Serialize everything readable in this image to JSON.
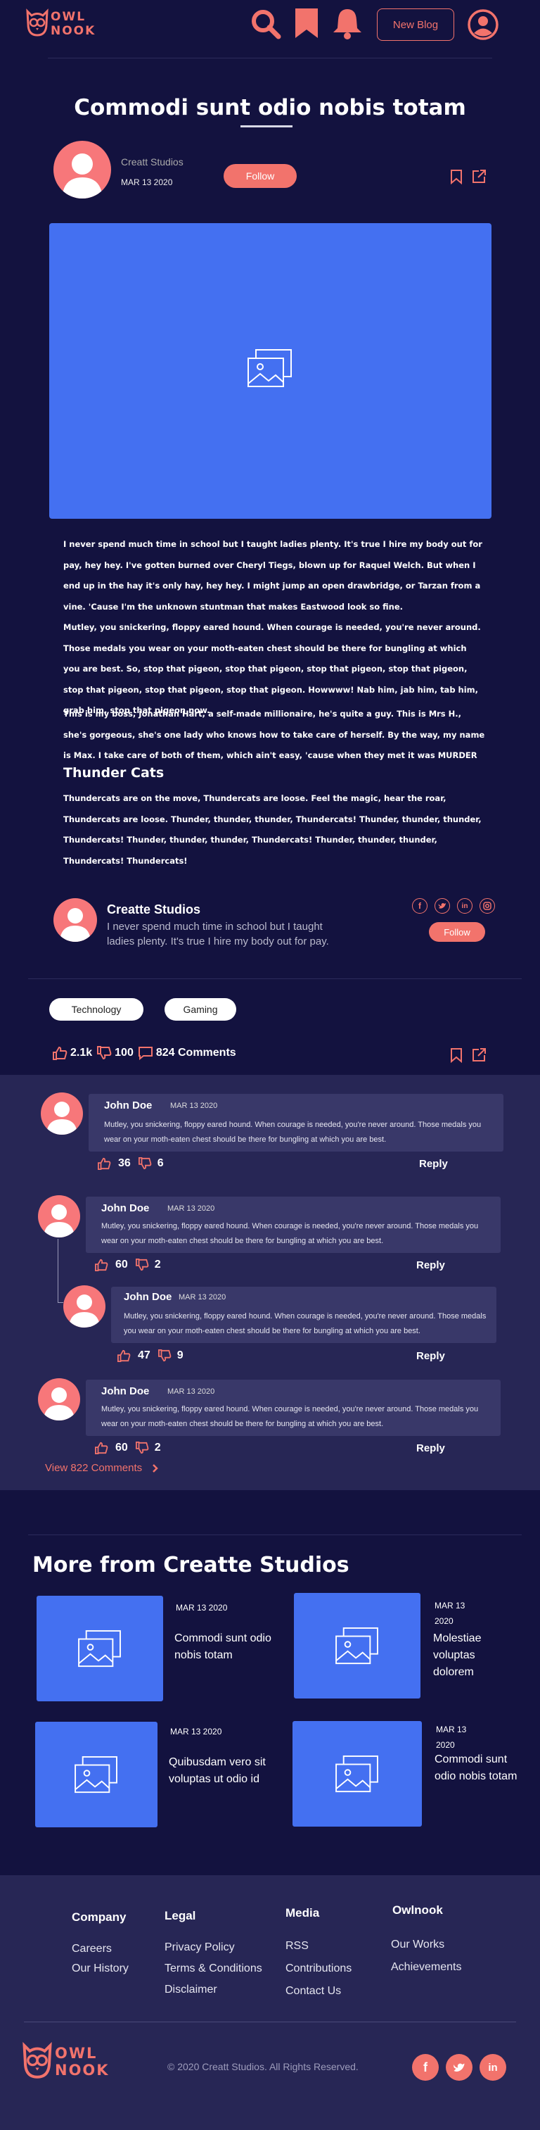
{
  "header": {
    "logo_line1": "OWL",
    "logo_line2": "NOOK",
    "new_blog": "New Blog"
  },
  "post": {
    "title": "Commodi sunt odio nobis totam",
    "author": "Creatt Studios",
    "date": "MAR 13 2020",
    "follow": "Follow",
    "paragraph1": "I never spend much time in school but I taught ladies plenty. It's true I hire my body out for pay, hey hey. I've gotten burned over Cheryl Tiegs, blown up for Raquel Welch. But when I end up in the hay it's only hay, hey hey. I might jump an open drawbridge, or Tarzan from a vine. 'Cause I'm the unknown stuntman that makes Eastwood look so fine.",
    "paragraph2": "Mutley, you snickering, floppy eared hound. When courage is needed, you're never around. Those medals you wear on your moth-eaten chest should be there for bungling at which you are best. So, stop that pigeon, stop that pigeon, stop that pigeon, stop that pigeon, stop that pigeon, stop that pigeon, stop that pigeon. Howwww! Nab him, jab him, tab him, grab him, stop that pigeon now.",
    "paragraph3": "This is my boss, Jonathan Hart, a self-made millionaire, he's quite a guy. This is Mrs H., she's gorgeous, she's one lady who knows how to take care of herself. By the way, my name is Max. I take care of both of them, which ain't easy, 'cause when they met it was MURDER",
    "subheading": "Thunder Cats",
    "paragraph4": "Thundercats are on the move, Thundercats are loose. Feel the magic, hear the roar, Thundercats are loose. Thunder, thunder, thunder, Thundercats! Thunder, thunder, thunder, Thundercats! Thunder, thunder, thunder, Thundercats! Thunder, thunder, thunder, Thundercats! Thundercats!"
  },
  "author_box": {
    "name": "Creatte Studios",
    "bio": "I never spend much time in school but I taught ladies plenty. It's true I hire my body out for pay.",
    "follow": "Follow"
  },
  "tags": [
    "Technology",
    "Gaming"
  ],
  "stats": {
    "likes": "2.1k",
    "dislikes": "100",
    "comments": "824 Comments"
  },
  "comments": [
    {
      "name": "John Doe",
      "date": "MAR 13 2020",
      "text": "Mutley, you snickering, floppy eared hound. When courage is needed, you're never around. Those medals you wear on your moth-eaten chest should be there for bungling at which you are best.",
      "likes": "36",
      "dislikes": "6",
      "reply": "Reply"
    },
    {
      "name": "John Doe",
      "date": "MAR 13 2020",
      "text": "Mutley, you snickering, floppy eared hound. When courage is needed, you're never around. Those medals you wear on your moth-eaten chest should be there for bungling at which you are best.",
      "likes": "60",
      "dislikes": "2",
      "reply": "Reply"
    },
    {
      "name": "John Doe",
      "date": "MAR 13 2020",
      "text": "Mutley, you snickering, floppy eared hound. When courage is needed, you're never around. Those medals you wear on your moth-eaten chest should be there for bungling at which you are best.",
      "likes": "47",
      "dislikes": "9",
      "reply": "Reply"
    },
    {
      "name": "John Doe",
      "date": "MAR 13 2020",
      "text": "Mutley, you snickering, floppy eared hound. When courage is needed, you're never around. Those medals you wear on your moth-eaten chest should be there for bungling at which you are best.",
      "likes": "60",
      "dislikes": "2",
      "reply": "Reply"
    }
  ],
  "view_more": "View 822 Comments",
  "more_from": {
    "heading": "More from Creatte Studios",
    "cards": [
      {
        "date": "MAR 13 2020",
        "title": "Commodi sunt odio nobis totam"
      },
      {
        "date": "MAR 13 2020",
        "title": "Molestiae voluptas dolorem"
      },
      {
        "date": "MAR 13 2020",
        "title": "Quibusdam vero sit voluptas ut odio id"
      },
      {
        "date": "MAR 13 2020",
        "title": "Commodi sunt odio nobis totam"
      }
    ]
  },
  "footer": {
    "columns": [
      {
        "heading": "Company",
        "links": [
          "Careers",
          "Our History"
        ]
      },
      {
        "heading": "Legal",
        "links": [
          "Privacy Policy",
          "Terms & Conditions",
          "Disclaimer"
        ]
      },
      {
        "heading": "Media",
        "links": [
          "RSS",
          "Contributions",
          "Contact Us"
        ]
      },
      {
        "heading": "Owlnook",
        "links": [
          "Our Works",
          "Achievements"
        ]
      }
    ],
    "copyright": "© 2020 Creatt Studios. All Rights Reserved."
  },
  "colors": {
    "background": "#13123f",
    "panel": "#272655",
    "accent": "#f2736c",
    "image_placeholder": "#4470f1"
  }
}
